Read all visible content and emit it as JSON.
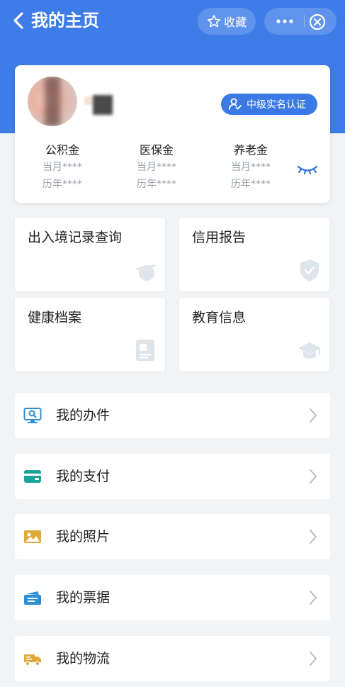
{
  "nav": {
    "title": "我的主页",
    "favorite_label": "收藏",
    "accent": "#3e7ce8"
  },
  "profile": {
    "verify_badge": "中级实名认证",
    "funds": [
      {
        "title": "公积金",
        "month": "当月****",
        "year": "历年****"
      },
      {
        "title": "医保金",
        "month": "当月****",
        "year": "历年****"
      },
      {
        "title": "养老金",
        "month": "当月****",
        "year": "历年****"
      }
    ]
  },
  "services": [
    {
      "label": "出入境记录查询",
      "icon": "airplane-icon"
    },
    {
      "label": "信用报告",
      "icon": "shield-check-icon"
    },
    {
      "label": "健康档案",
      "icon": "health-record-icon"
    },
    {
      "label": "教育信息",
      "icon": "graduation-cap-icon"
    }
  ],
  "list": [
    {
      "label": "我的办件",
      "icon": "monitor-search-icon",
      "color": "#2f8fd6"
    },
    {
      "label": "我的支付",
      "icon": "card-icon",
      "color": "#1aa39a"
    },
    {
      "label": "我的照片",
      "icon": "photo-icon",
      "color": "#e0a83b"
    },
    {
      "label": "我的票据",
      "icon": "receipt-icon",
      "color": "#2f8fd6"
    },
    {
      "label": "我的物流",
      "icon": "truck-icon",
      "color": "#e0a83b"
    }
  ]
}
